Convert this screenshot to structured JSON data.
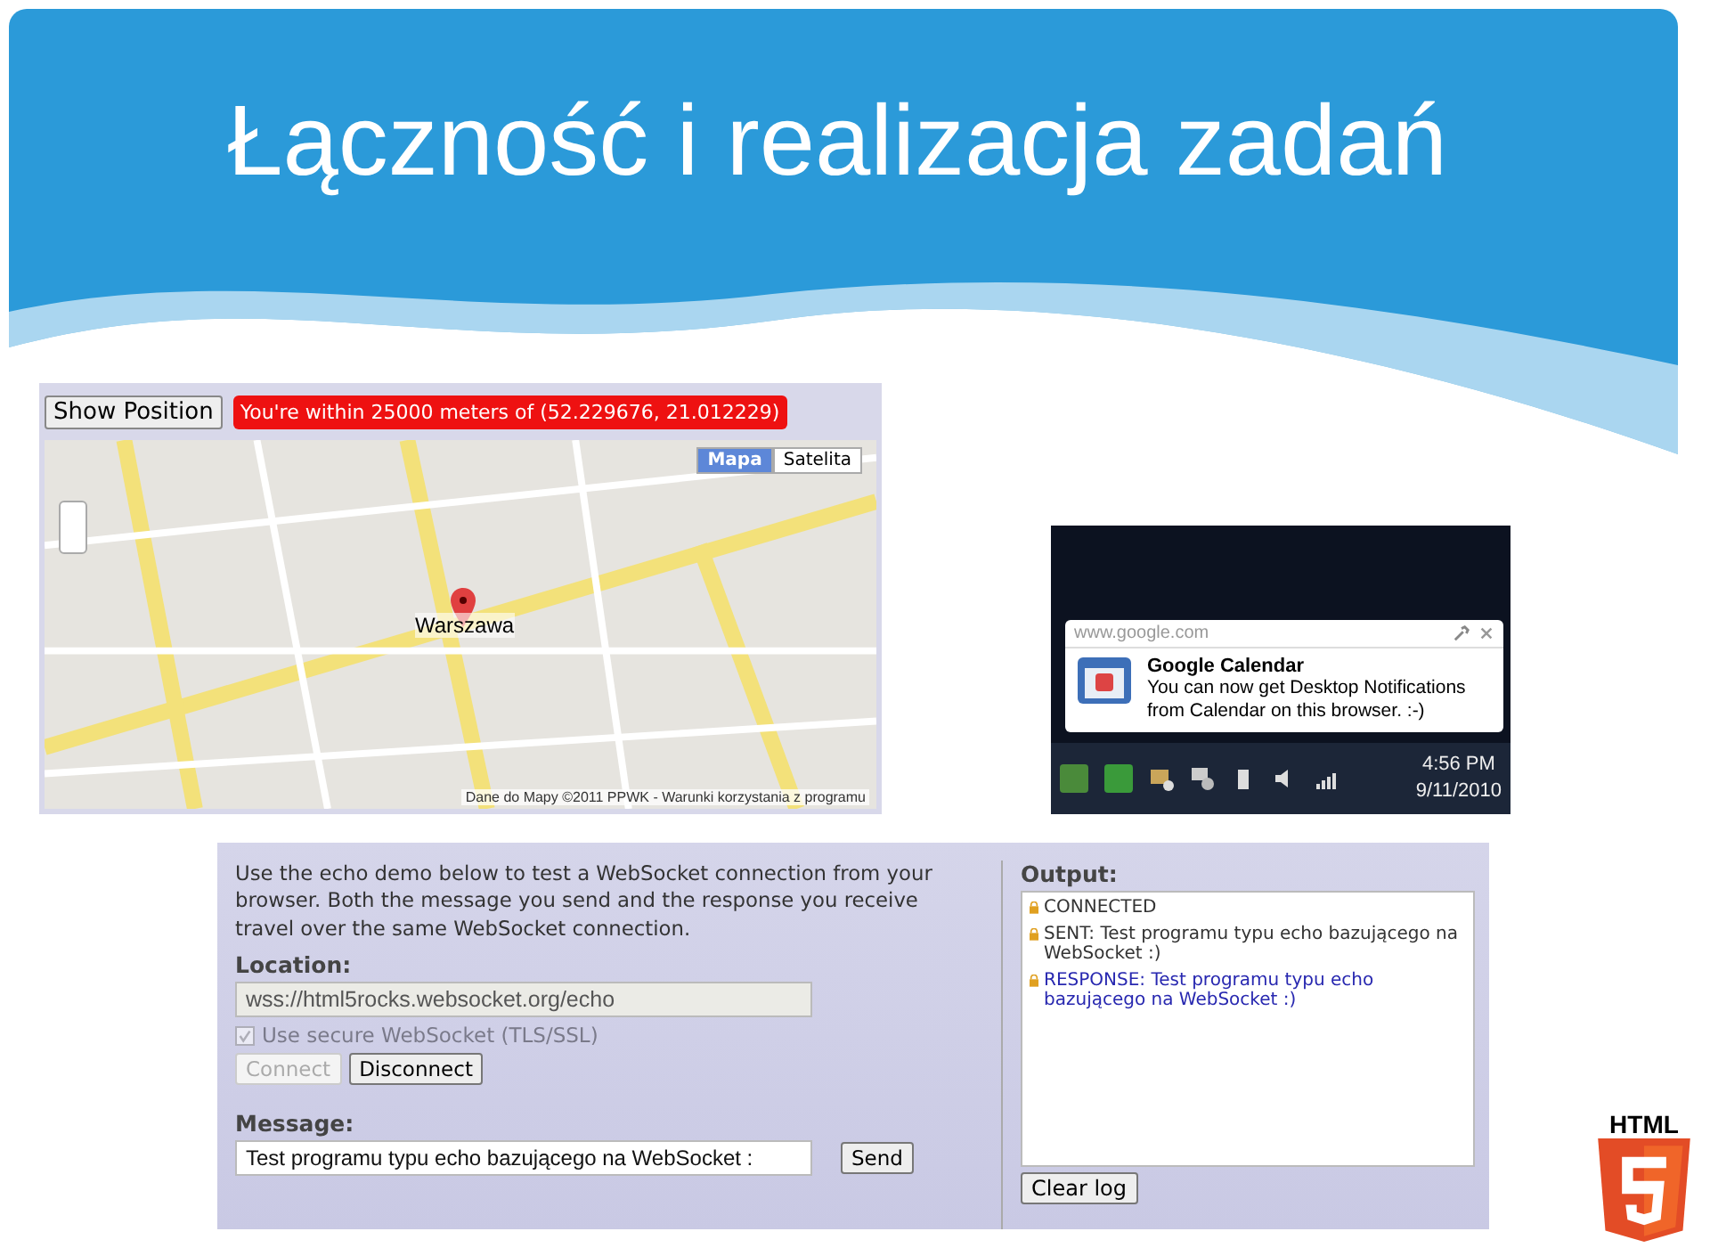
{
  "title": "Łączność i realizacja zadań",
  "geolocation": {
    "button": "Show Position",
    "status": "You're within 25000 meters of (52.229676, 21.012229)",
    "map_types": [
      {
        "label": "Mapa",
        "selected": true
      },
      {
        "label": "Satelita",
        "selected": false
      }
    ],
    "place": "Warszawa",
    "attribution": "Dane do Mapy ©2011 PPWK - Warunki korzystania z programu"
  },
  "notification": {
    "origin": "www.google.com",
    "title": "Google Calendar",
    "body": "You can now get Desktop Notifications from Calendar on this browser. :-)",
    "time": "4:56 PM",
    "date": "9/11/2010"
  },
  "websocket": {
    "intro": "Use the echo demo below to test a WebSocket connection from your browser. Both the message you send and the response you receive travel over the same WebSocket connection.",
    "location_label": "Location:",
    "location": "wss://html5rocks.websocket.org/echo",
    "secure": {
      "label": "Use secure WebSocket (TLS/SSL)",
      "checked": true,
      "disabled": true
    },
    "buttons": [
      {
        "label": "Connect",
        "disabled": true
      },
      {
        "label": "Disconnect",
        "disabled": false
      }
    ],
    "message_label": "Message:",
    "message": "Test programu typu echo bazującego na WebSocket :",
    "send": "Send",
    "output_label": "Output:",
    "log": [
      {
        "kind": "info",
        "text": "CONNECTED"
      },
      {
        "kind": "sent",
        "text": "SENT: Test programu typu echo bazującego na WebSocket :)"
      },
      {
        "kind": "response",
        "text": "RESPONSE: Test programu typu echo bazującego na WebSocket :)"
      }
    ],
    "clear": "Clear log"
  },
  "logo": {
    "label": "HTML"
  }
}
